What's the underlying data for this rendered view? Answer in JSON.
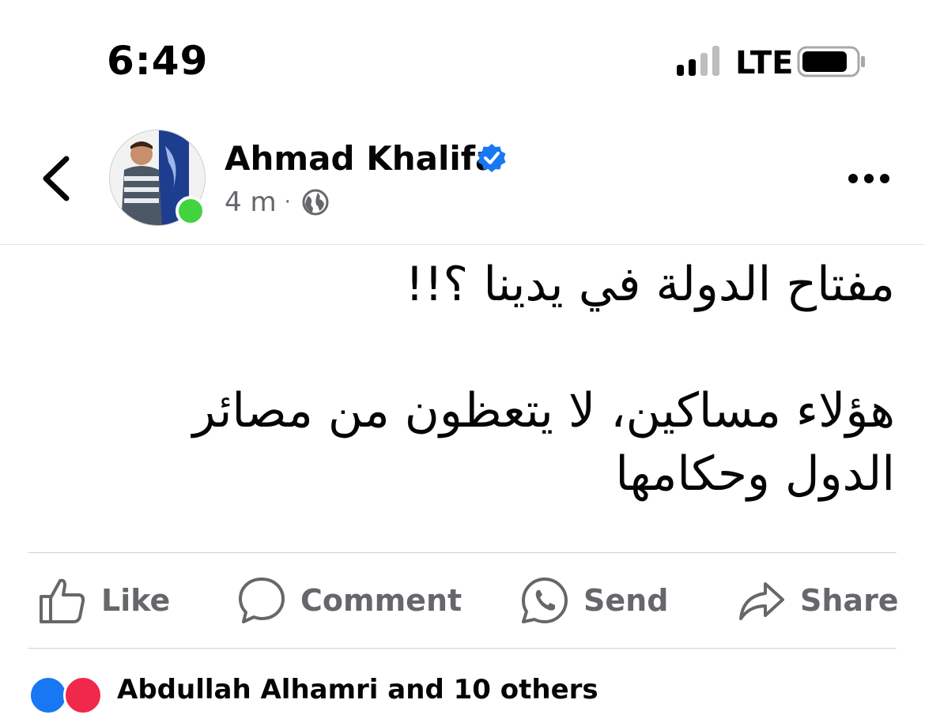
{
  "status_bar": {
    "time": "6:49",
    "carrier": "LTE",
    "signal_icon": "signal-bars-icon",
    "battery_icon": "battery-icon"
  },
  "post": {
    "author_name": "Ahmad Khalifa",
    "verified_icon": "verified-badge-icon",
    "timestamp": "4 m",
    "separator": "·",
    "audience_icon": "globe-icon",
    "body_lines": [
      "مفتاح الدولة في يدينا ؟!!",
      "",
      "هؤلاء مساكين، لا يتعظون من مصائر",
      "الدول وحكامها"
    ]
  },
  "actions": {
    "like": "Like",
    "comment": "Comment",
    "send": "Send",
    "share": "Share"
  },
  "reactions": {
    "text": "Abdullah Alhamri and 10 others"
  },
  "colors": {
    "brand_blue": "#1877f2",
    "secondary_text": "#65676b",
    "online_green": "#42d33f"
  }
}
